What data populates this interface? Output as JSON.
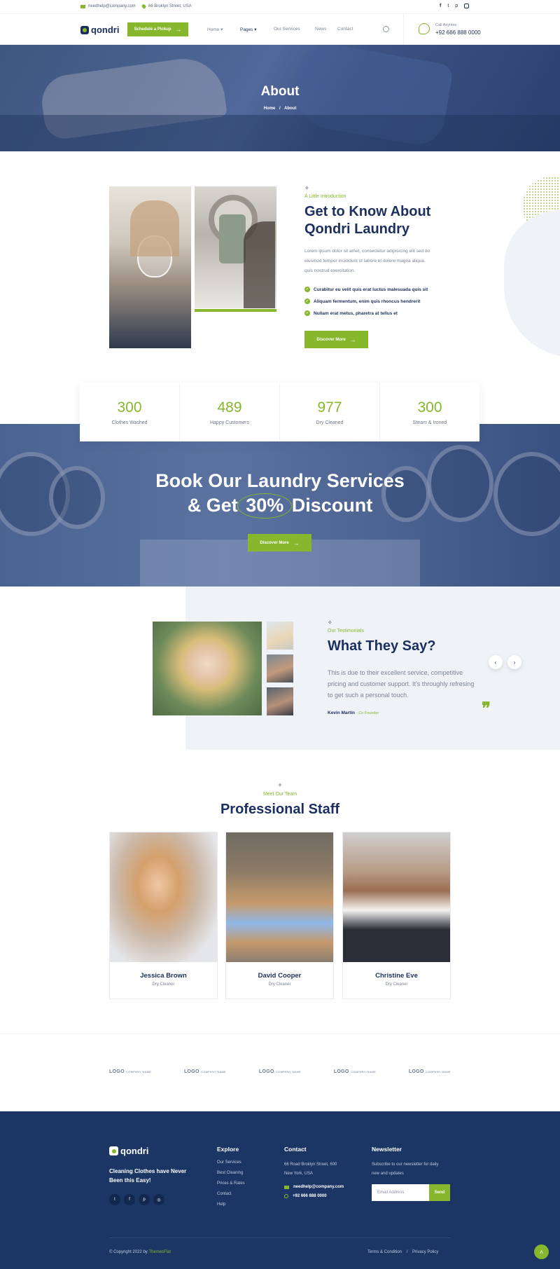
{
  "topbar": {
    "email": "needhelp@company.com",
    "address": "66 Broklyn Street, USA",
    "socials": [
      "facebook-icon",
      "twitter-icon",
      "pinterest-icon",
      "instagram-icon"
    ]
  },
  "header": {
    "logo_text": "qondri",
    "pickup_button": "Schedule a Pickup",
    "nav": [
      "Home",
      "Pages",
      "Our Services",
      "News",
      "Contact"
    ],
    "call_label": "Call Anytime",
    "call_number": "+92 666 888 0000"
  },
  "hero": {
    "title": "About",
    "breadcrumb_home": "Home",
    "breadcrumb_sep": "/",
    "breadcrumb_current": "About"
  },
  "about": {
    "tagline": "A Little Introduction",
    "title_line1": "Get to Know About",
    "title_line2": "Qondri Laundry",
    "body_line1": "Lorem ipsum dolor sit amet, consectetur adipisicing elit sed do",
    "body_line2": "eiusmod tempor incididunt ut labore et dolore magna aliqua.",
    "body_line3": "quis nostrud exercitation.",
    "checks": [
      "Curabitur eu velit quis erat luctus malesuada quis sit",
      "Aliquam fermentum, enim quis rhoncus hendrerit",
      "Nullam erat metus, pharetra at tellus et"
    ],
    "button": "Discover More"
  },
  "counters": [
    {
      "value": "300",
      "label": "Clothes Washed"
    },
    {
      "value": "489",
      "label": "Happy Customers"
    },
    {
      "value": "977",
      "label": "Dry Cleaned"
    },
    {
      "value": "300",
      "label": "Steam & Ironed"
    }
  ],
  "book": {
    "line1": "Book Our Laundry Services",
    "line2_pre": "& Get",
    "line2_highlight": "30%",
    "line2_post": "Discount",
    "button": "Discover More"
  },
  "testimonials": {
    "tagline": "Our Testimonials",
    "title": "What They Say?",
    "quote_line1": "This is due to their excellent service, competitive",
    "quote_line2": "pricing and customer support. It's throughly refresing",
    "quote_line3": "to get such a personal touch.",
    "author": "Kevin Martin",
    "author_role": "- Co Founder"
  },
  "staff": {
    "tagline": "Meet Our Team",
    "title": "Professional Staff",
    "members": [
      {
        "name": "Jessica Brown",
        "role": "Dry Cleaner"
      },
      {
        "name": "David Cooper",
        "role": "Dry Cleaner"
      },
      {
        "name": "Christine Eve",
        "role": "Dry Cleaner"
      }
    ]
  },
  "logos": [
    {
      "text": "LOGO",
      "small": "COMPANY NAME"
    },
    {
      "text": "LOGO",
      "small": "COMPANY NAME"
    },
    {
      "text": "LOGO",
      "small": "COMPANY NAME"
    },
    {
      "text": "LOGO",
      "small": "COMPANY NAME"
    },
    {
      "text": "LOGO",
      "small": "COMPANY NAME"
    }
  ],
  "footer": {
    "logo_text": "qondri",
    "slogan_line1": "Cleaning Clothes have Never",
    "slogan_line2": "Been this Easy!",
    "explore_title": "Explore",
    "explore_links": [
      "Our Services",
      "Best Cleaning",
      "Prices & Rates",
      "Contact",
      "Help"
    ],
    "contact_title": "Contact",
    "contact_addr1": "66 Road Broklyn Street, 600",
    "contact_addr2": "New York, USA",
    "contact_email": "needhelp@company.com",
    "contact_phone": "+92 666 888 0000",
    "newsletter_title": "Newsletter",
    "newsletter_line1": "Subscribe to our newsletter for daily",
    "newsletter_line2": "new and updates",
    "email_placeholder": "Email Address",
    "send_button": "Send",
    "copyright_pre": "© Copyright 2022 by",
    "copyright_brand": "ThemesFlat",
    "terms": "Terms & Condition",
    "sep": "/",
    "privacy": "Privacy Policy"
  },
  "colors": {
    "accent": "#86b72c",
    "navy": "#1c3060",
    "footer": "#1b3564"
  }
}
